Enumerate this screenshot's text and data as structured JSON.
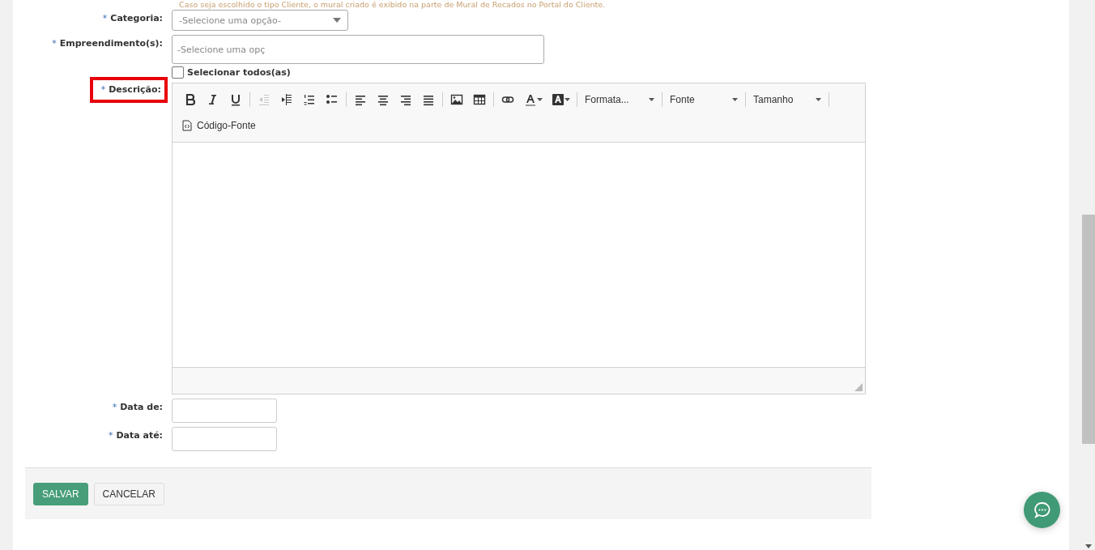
{
  "hint": "Caso seja escolhido o tipo Cliente, o mural criado é exibido na parte de Mural de Recados no Portal do Cliente.",
  "fields": [
    {
      "kind": "select",
      "asterisk": "*",
      "label": "Categoria:",
      "placeholder": "-Selecione uma opção-",
      "highlighted": false
    },
    {
      "kind": "multi",
      "asterisk": "*",
      "label": "Empreendimento(s):",
      "placeholder": "-Selecione uma opç",
      "select_all": {
        "label": "Selecionar todos(as)",
        "checked": false
      },
      "highlighted": false
    },
    {
      "kind": "editor",
      "asterisk": "*",
      "label": "Descrição:",
      "highlighted": true
    },
    {
      "kind": "date",
      "asterisk": "*",
      "label": "Data de:",
      "highlighted": false
    },
    {
      "kind": "date",
      "asterisk": "*",
      "label": "Data até:",
      "highlighted": false
    }
  ],
  "toolbar": [
    [
      {
        "kind": "bold",
        "disabled": false
      },
      {
        "kind": "italic",
        "disabled": false
      },
      {
        "kind": "underline",
        "disabled": false
      },
      {
        "kind": "separator"
      },
      {
        "kind": "outdent",
        "disabled": true
      },
      {
        "kind": "indent",
        "disabled": false
      },
      {
        "kind": "numbered-list",
        "disabled": false
      },
      {
        "kind": "bulleted-list",
        "disabled": false
      },
      {
        "kind": "separator"
      },
      {
        "kind": "align-left",
        "disabled": false
      },
      {
        "kind": "align-center",
        "disabled": false
      },
      {
        "kind": "align-right",
        "disabled": false
      },
      {
        "kind": "justify",
        "disabled": false
      },
      {
        "kind": "separator"
      },
      {
        "kind": "image",
        "disabled": false
      },
      {
        "kind": "table",
        "disabled": false
      },
      {
        "kind": "separator"
      },
      {
        "kind": "link",
        "disabled": false
      },
      {
        "kind": "text-color",
        "disabled": false
      },
      {
        "kind": "background-color",
        "disabled": false
      },
      {
        "kind": "separator"
      },
      {
        "kind": "dropdown",
        "label": "Formata..."
      },
      {
        "kind": "separator"
      },
      {
        "kind": "dropdown",
        "label": "Fonte"
      },
      {
        "kind": "separator"
      },
      {
        "kind": "dropdown",
        "label": "Tamanho"
      },
      {
        "kind": "separator"
      }
    ],
    [
      {
        "kind": "source",
        "label": "Código-Fonte"
      }
    ]
  ],
  "buttons": [
    {
      "label": "SALVAR",
      "kind": "primary"
    },
    {
      "label": "CANCELAR",
      "kind": "secondary"
    }
  ]
}
